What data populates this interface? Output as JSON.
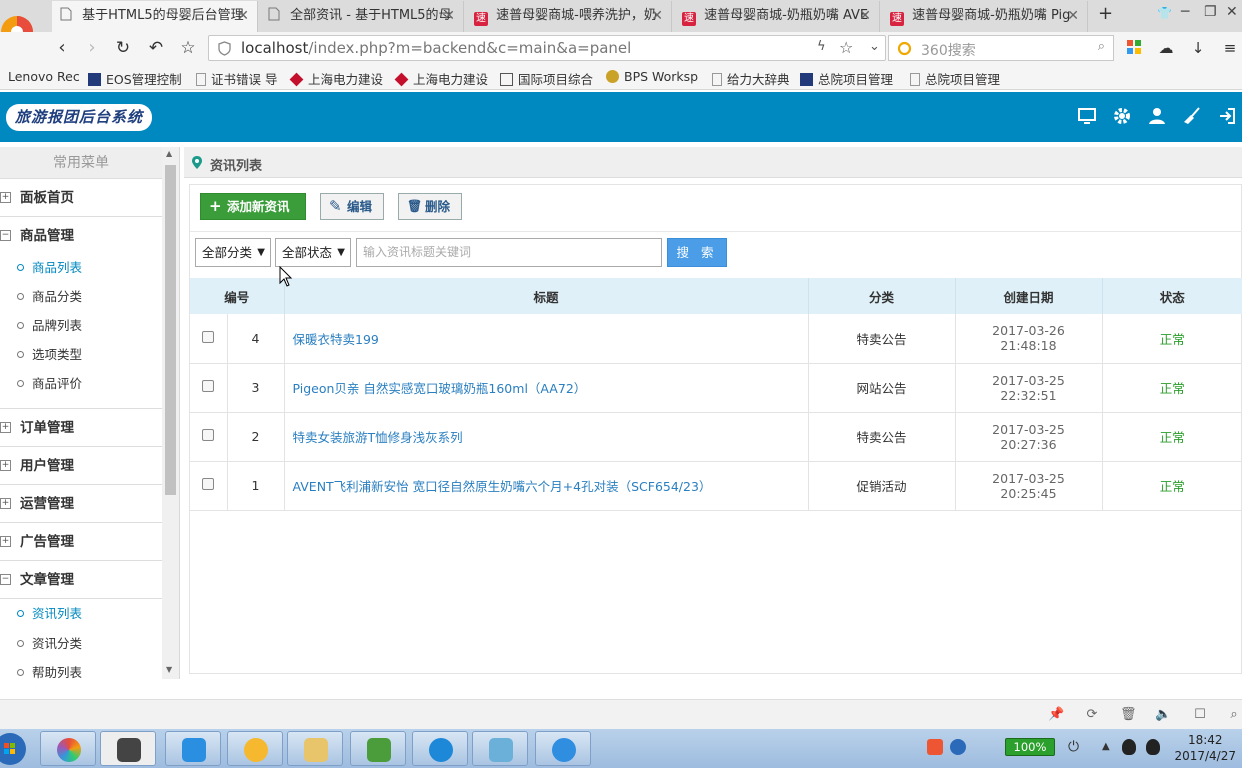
{
  "browser": {
    "tabs": [
      {
        "title": "基于HTML5的母婴后台管理",
        "active": true
      },
      {
        "title": "全部资讯 - 基于HTML5的母",
        "active": false
      },
      {
        "title": "速普母婴商城-喂养洗护，奶",
        "active": false
      },
      {
        "title": "速普母婴商城-奶瓶奶嘴 AVE",
        "active": false
      },
      {
        "title": "速普母婴商城-奶瓶奶嘴 Pig",
        "active": false
      }
    ],
    "new_tab": "+",
    "close": "✕",
    "site_icon_text": "速",
    "url_host": "localhost",
    "url_path": "/index.php?m=backend&c=main&a=panel",
    "search_placeholder": "360搜索",
    "bookmarks": [
      "Lenovo Rec",
      "EOS管理控制",
      "证书错误 导",
      "上海电力建设",
      "上海电力建设",
      "国际项目综合",
      "BPS Worksp",
      "给力大辞典",
      "总院项目管理",
      "总院项目管理"
    ]
  },
  "app": {
    "title": "旅游报团后台系统",
    "header_icons": [
      "monitor-icon",
      "gear-icon",
      "user-icon",
      "broom-icon",
      "logout-icon"
    ]
  },
  "sidebar": {
    "title": "常用菜单",
    "groups": [
      {
        "label": "面板首页",
        "mark": "+"
      },
      {
        "label": "商品管理",
        "mark": "−"
      },
      {
        "label": "订单管理",
        "mark": "+"
      },
      {
        "label": "用户管理",
        "mark": "+"
      },
      {
        "label": "运营管理",
        "mark": "+"
      },
      {
        "label": "广告管理",
        "mark": "+"
      },
      {
        "label": "文章管理",
        "mark": "−"
      }
    ],
    "goods_items": [
      "商品列表",
      "商品分类",
      "品牌列表",
      "选项类型",
      "商品评价"
    ],
    "article_items": [
      "资讯列表",
      "资讯分类",
      "帮助列表"
    ]
  },
  "breadcrumb": "资讯列表",
  "toolbar": {
    "add_label": "添加新资讯",
    "add_icon": "+",
    "edit_label": "编辑",
    "edit_icon": "✎",
    "delete_label": "删除",
    "delete_icon": "🗑"
  },
  "filters": {
    "category": "全部分类",
    "status": "全部状态",
    "arrow": "▼",
    "keyword_placeholder": "输入资讯标题关键词",
    "search_label": "搜 索"
  },
  "table": {
    "headers": [
      "编号",
      "标题",
      "分类",
      "创建日期",
      "状态"
    ],
    "rows": [
      {
        "id": "4",
        "title": "保暖衣特卖199",
        "category": "特卖公告",
        "date": "2017-03-26",
        "time": "21:48:18",
        "status": "正常"
      },
      {
        "id": "3",
        "title": "Pigeon贝亲 自然实感宽口玻璃奶瓶160ml（AA72）",
        "category": "网站公告",
        "date": "2017-03-25",
        "time": "22:32:51",
        "status": "正常"
      },
      {
        "id": "2",
        "title": "特卖女装旅游T恤修身浅灰系列",
        "category": "特卖公告",
        "date": "2017-03-25",
        "time": "20:27:36",
        "status": "正常"
      },
      {
        "id": "1",
        "title": "AVENT飞利浦新安怡 宽口径自然原生奶嘴六个月+4孔对装（SCF654/23）",
        "category": "促销活动",
        "date": "2017-03-25",
        "time": "20:25:45",
        "status": "正常"
      }
    ]
  },
  "taskbar": {
    "battery": "100%",
    "time": "18:42",
    "date": "2017/4/27"
  },
  "colors": {
    "header": "#0088c0",
    "link": "#2a7fc0",
    "status_ok": "#2a9d2a",
    "add_button": "#3a9d3a",
    "search_button": "#4a9de6"
  }
}
